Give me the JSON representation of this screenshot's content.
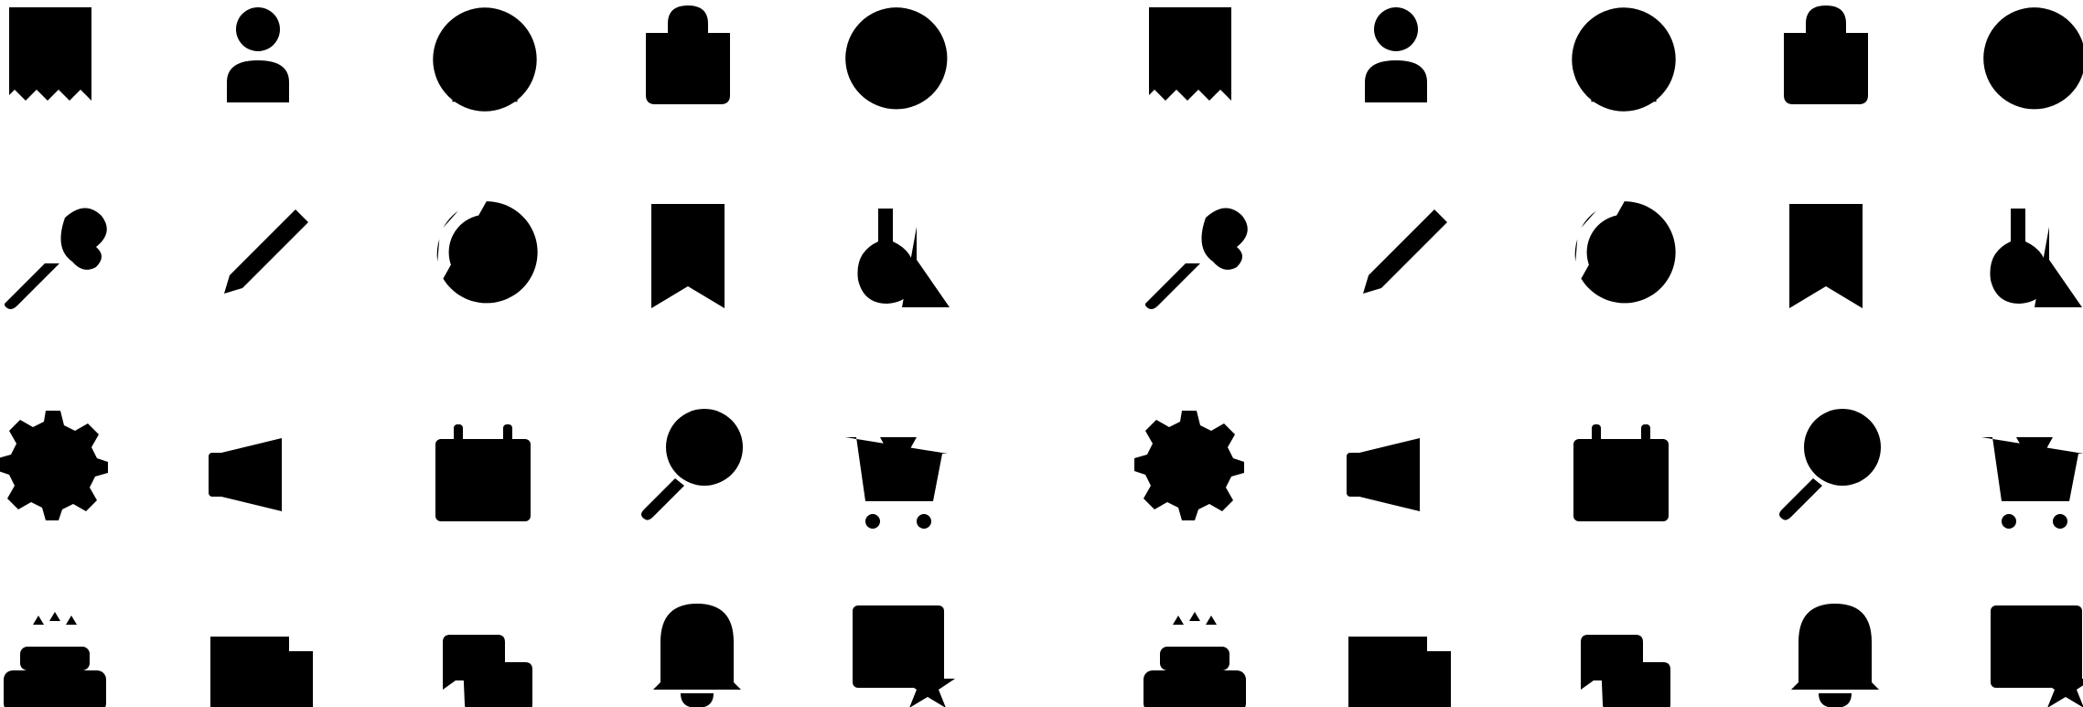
{
  "palette": {
    "stroke": "#3c3b4a",
    "accent": "#58f1f7",
    "gradient_start": "#4fe5f6",
    "gradient_end": "#9b5bd6",
    "background": "#ffffff"
  },
  "icon_sets": [
    {
      "style": "filled-accent",
      "icons": [
        "receipt-icon",
        "add-user-icon",
        "user-profile-icon",
        "shopping-bag-icon",
        "verified-badge-icon",
        "magic-wand-icon",
        "pencil-icon",
        "image-add-icon",
        "video-bookmark-icon",
        "flask-icon",
        "gear-icon",
        "megaphone-icon",
        "calendar-icon",
        "search-compass-icon",
        "shopping-cart-icon",
        "birthday-cake-icon",
        "newspaper-icon",
        "chat-bubbles-icon",
        "bell-icon",
        "video-favorite-icon"
      ]
    },
    {
      "style": "gradient-outline",
      "icons": [
        "receipt-icon",
        "add-user-icon",
        "user-profile-icon",
        "shopping-bag-icon",
        "verified-badge-icon",
        "magic-wand-icon",
        "pencil-icon",
        "image-add-icon",
        "video-bookmark-icon",
        "flask-icon",
        "gear-icon",
        "megaphone-icon",
        "calendar-icon",
        "search-compass-icon",
        "shopping-cart-icon",
        "birthday-cake-icon",
        "newspaper-icon",
        "chat-bubbles-icon",
        "bell-icon",
        "video-favorite-icon"
      ]
    }
  ]
}
